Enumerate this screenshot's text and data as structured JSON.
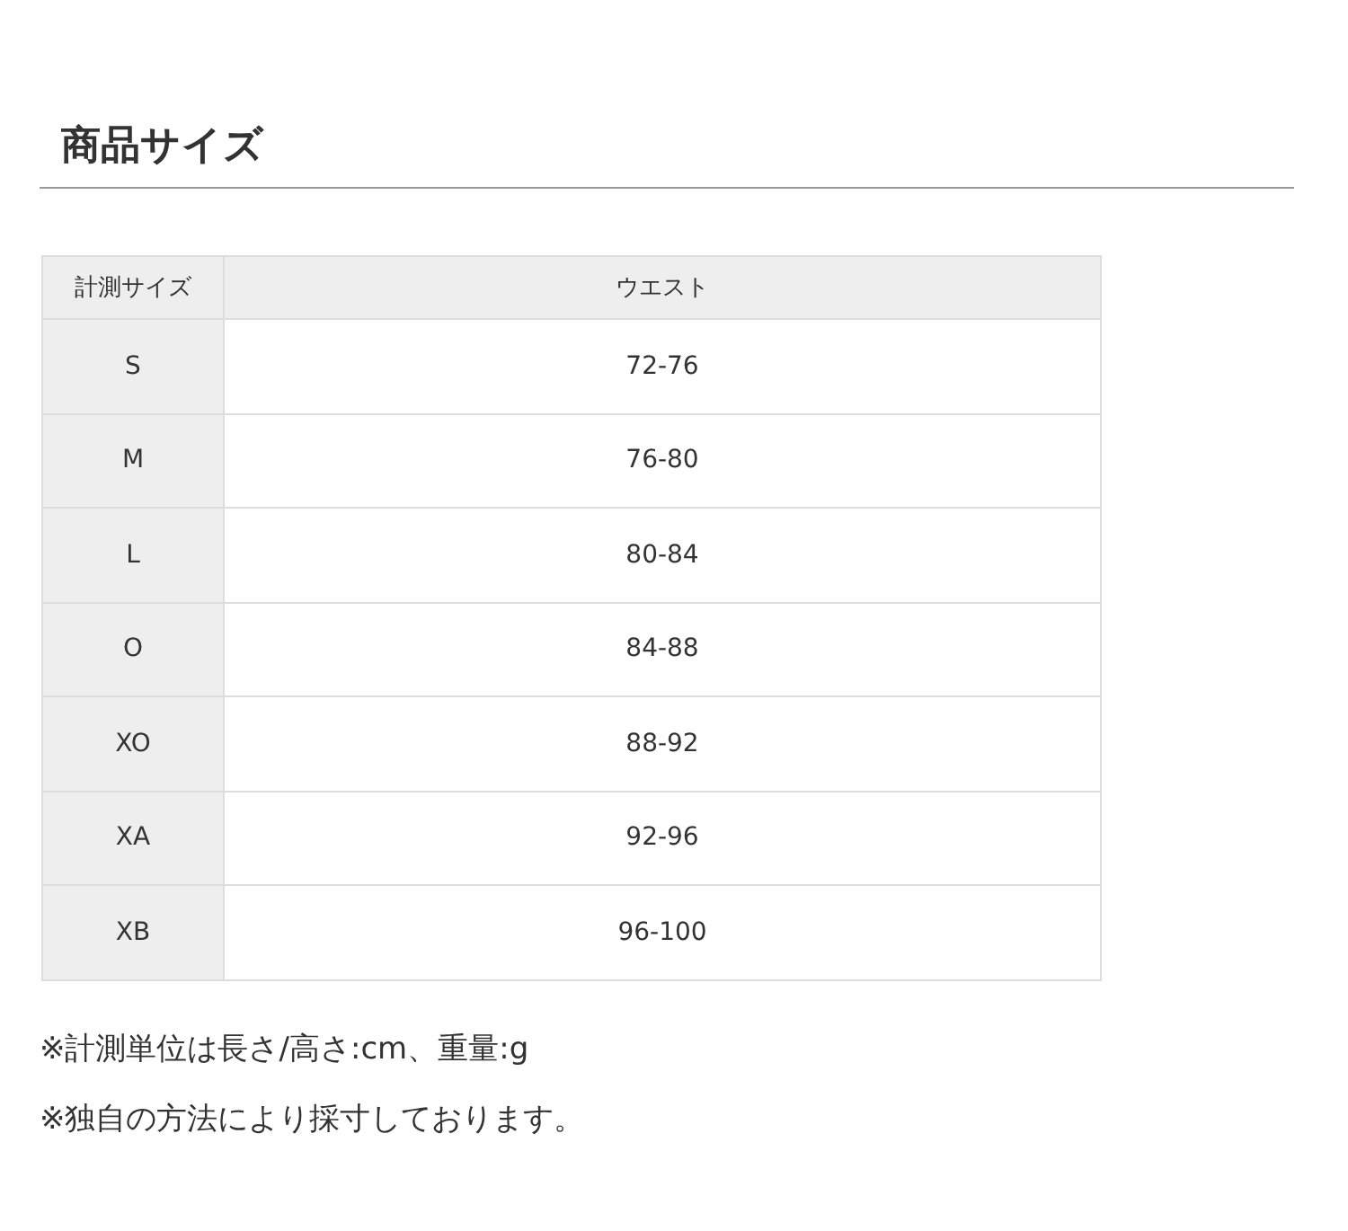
{
  "title": "商品サイズ",
  "table": {
    "columns": [
      "計測サイズ",
      "ウエスト"
    ],
    "rows": [
      [
        "S",
        "72-76"
      ],
      [
        "M",
        "76-80"
      ],
      [
        "L",
        "80-84"
      ],
      [
        "O",
        "84-88"
      ],
      [
        "XO",
        "88-92"
      ],
      [
        "XA",
        "92-96"
      ],
      [
        "XB",
        "96-100"
      ]
    ]
  },
  "notes": [
    "※計測単位は長さ/高さ:cm、重量:g",
    "※独自の方法により採寸しております。"
  ]
}
